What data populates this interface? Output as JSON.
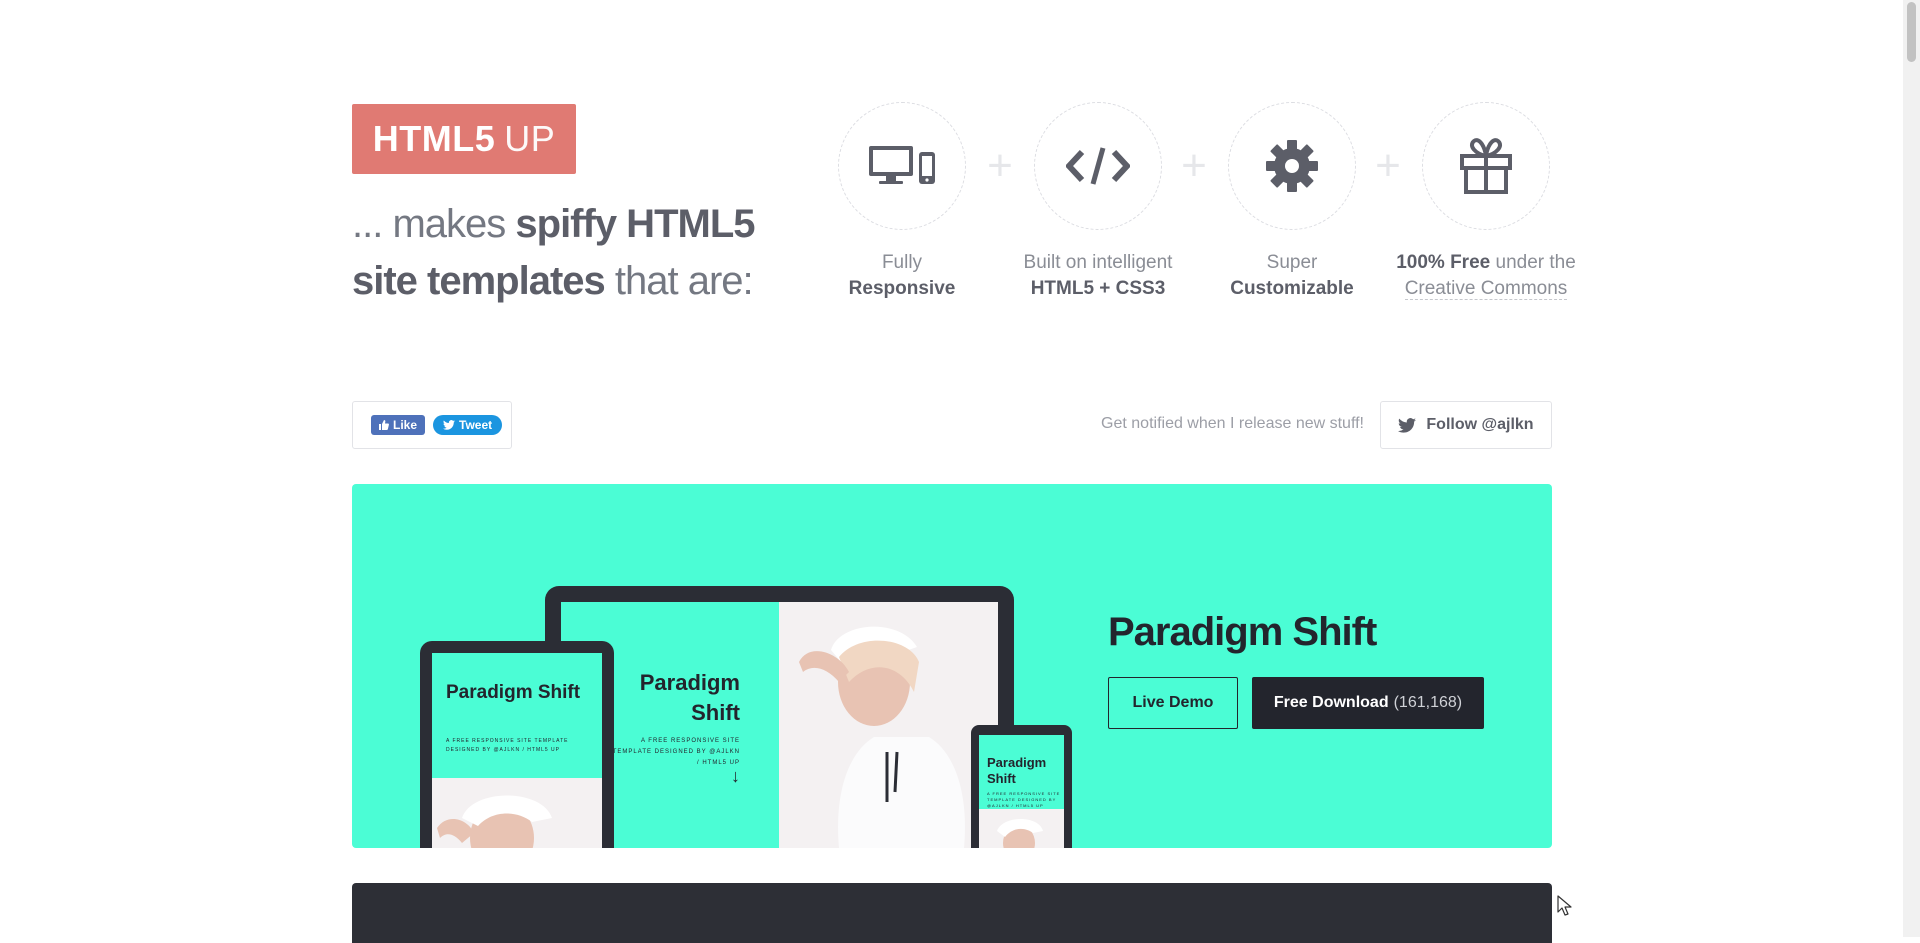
{
  "header": {
    "logo": {
      "bold": "HTML5",
      "light": "UP"
    },
    "tagline": {
      "line1_light": "... makes ",
      "line1_bold": "spiffy HTML5",
      "line2_bold": "site templates",
      "line2_light": " that are:"
    },
    "features": [
      {
        "icon": "devices-icon",
        "light": "Fully",
        "bold": "Responsive"
      },
      {
        "icon": "code-icon",
        "light": "Built on intelligent",
        "bold": "HTML5 + CSS3"
      },
      {
        "icon": "gear-icon",
        "light": "Super",
        "bold": "Customizable"
      },
      {
        "icon": "gift-icon",
        "bold": "100% Free",
        "light": " under the",
        "link": "Creative Commons"
      }
    ],
    "plus": "+"
  },
  "social": {
    "like_label": "Like",
    "tweet_label": "Tweet",
    "notify_text": "Get notified when I release new stuff!",
    "follow_label": "Follow @ajlkn"
  },
  "banner": {
    "title": "Paradigm Shift",
    "mock_title": "Paradigm Shift",
    "mock_sub": "A FREE RESPONSIVE SITE TEMPLATE DESIGNED BY @AJLKN / HTML5 UP",
    "mock_arrow": "↓",
    "live_demo_label": "Live Demo",
    "download_label": "Free Download",
    "download_count": "(161,168)",
    "bg_color": "#4bfdd5",
    "dark_color": "#23252d"
  },
  "colors": {
    "logo": "#e07a73",
    "text": "#5c5e68",
    "facebook": "#4e71ba",
    "twitter": "#1b95e0"
  }
}
